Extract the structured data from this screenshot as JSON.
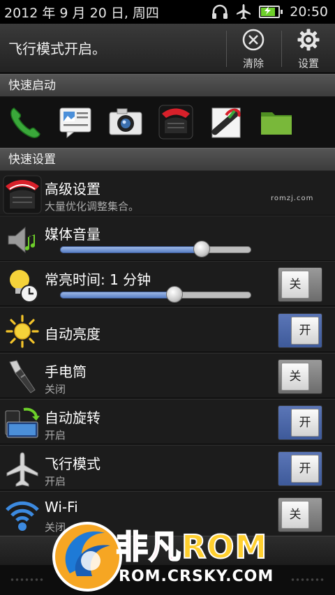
{
  "status_bar": {
    "date": "2012 年 9 月 20 日, 周四",
    "time": "20:50",
    "icons": [
      "headphones-icon",
      "airplane-mode-icon",
      "battery-charging-icon"
    ],
    "battery_level": 0.9
  },
  "notification_header": {
    "message": "飞行模式开启。",
    "clear_label": "清除",
    "settings_label": "设置"
  },
  "quick_launch": {
    "title": "快速启动",
    "apps": [
      "phone-icon",
      "messages-icon",
      "camera-icon",
      "htc-app-icon",
      "voice-recorder-icon",
      "folder-icon"
    ]
  },
  "quick_settings": {
    "title": "快速设置",
    "items": [
      {
        "title": "高级设置",
        "subtitle": "大量优化调整集合。",
        "note": "romzj.com",
        "icon": "advanced-settings-icon"
      },
      {
        "title": "媒体音量",
        "icon": "media-volume-icon",
        "slider_value": 0.74
      },
      {
        "title": "常亮时间: 1 分钟",
        "icon": "screen-timeout-icon",
        "slider_value": 0.6,
        "toggle": "关",
        "toggle_on": false
      },
      {
        "title": "自动亮度",
        "icon": "auto-brightness-icon",
        "toggle": "开",
        "toggle_on": true
      },
      {
        "title": "手电筒",
        "subtitle": "关闭",
        "icon": "flashlight-icon",
        "toggle": "关",
        "toggle_on": false
      },
      {
        "title": "自动旋转",
        "subtitle": "开启",
        "icon": "auto-rotate-icon",
        "toggle": "开",
        "toggle_on": true
      },
      {
        "title": "飞行模式",
        "subtitle": "开启",
        "icon": "airplane-icon",
        "toggle": "开",
        "toggle_on": true
      },
      {
        "title": "Wi-Fi",
        "subtitle": "关闭",
        "icon": "wifi-icon",
        "toggle": "关",
        "toggle_on": false
      }
    ]
  },
  "watermark": {
    "brand_cn": "非凡",
    "brand_rom": "ROM",
    "url": "ROM.CRSKY.COM"
  },
  "colors": {
    "toggle_on": "#4a66a8",
    "slider_fill": "#6f8fd2",
    "background": "#1a1a1a"
  }
}
